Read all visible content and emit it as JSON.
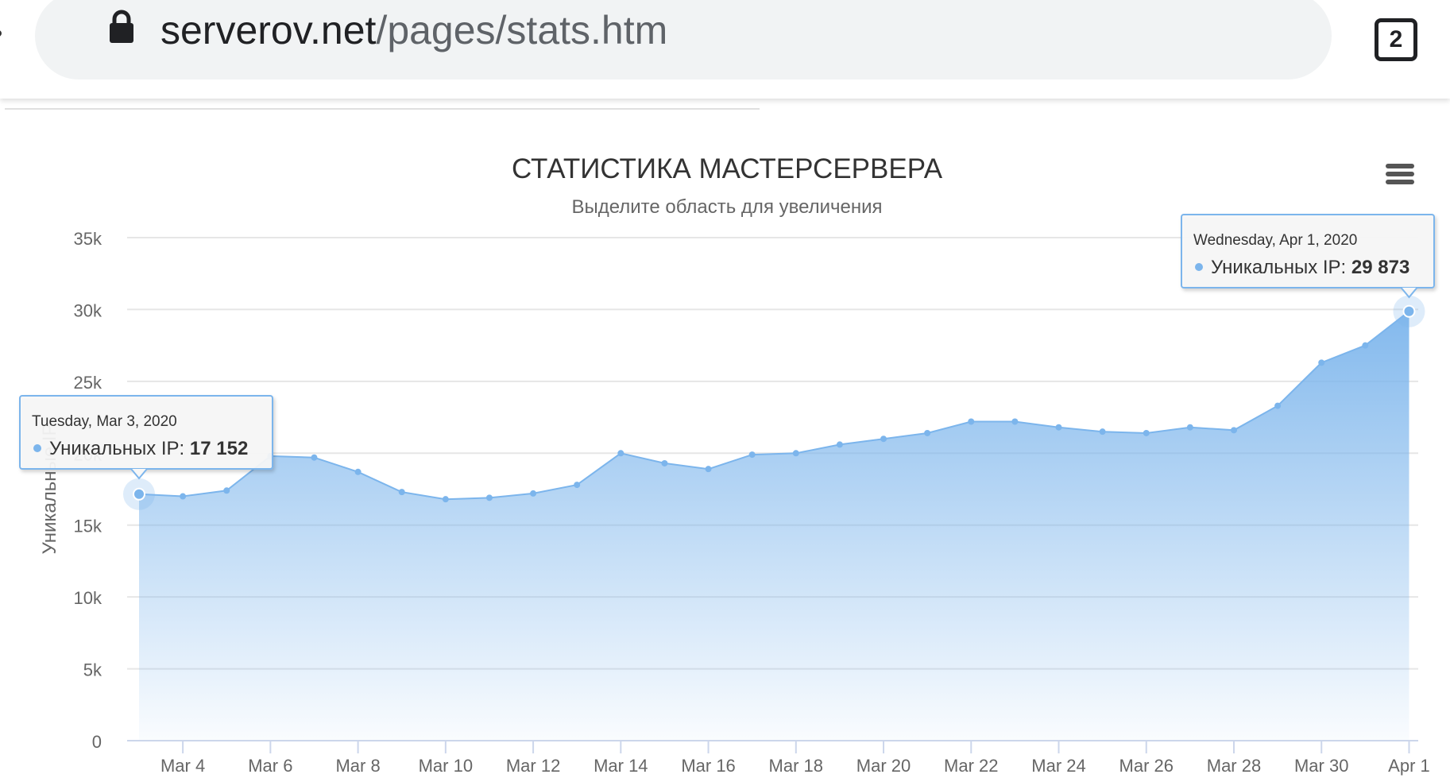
{
  "browser": {
    "url_domain": "serverov.net",
    "url_path": "/pages/stats.htm",
    "tab_count": "2",
    "lock_icon": "lock-icon",
    "menu_icon": "hamburger-menu-icon"
  },
  "chart_data": {
    "type": "area",
    "title": "СТАТИСТИКА МАСТЕРСЕРВЕРА",
    "subtitle": "Выделите область для увеличения",
    "ylabel": "Уникальные IP",
    "ylim": [
      0,
      35000
    ],
    "yticks": [
      "0",
      "5k",
      "10k",
      "15k",
      "20k",
      "25k",
      "30k",
      "35k"
    ],
    "xticks": [
      "Mar 4",
      "Mar 6",
      "Mar 8",
      "Mar 10",
      "Mar 12",
      "Mar 14",
      "Mar 16",
      "Mar 18",
      "Mar 20",
      "Mar 22",
      "Mar 24",
      "Mar 26",
      "Mar 28",
      "Mar 30",
      "Apr 1"
    ],
    "color": "#7cb5ec",
    "grid": true,
    "legend": "none",
    "series": [
      {
        "name": "Уникальных IP",
        "x": [
          "2020-03-03",
          "2020-03-04",
          "2020-03-05",
          "2020-03-06",
          "2020-03-07",
          "2020-03-08",
          "2020-03-09",
          "2020-03-10",
          "2020-03-11",
          "2020-03-12",
          "2020-03-13",
          "2020-03-14",
          "2020-03-15",
          "2020-03-16",
          "2020-03-17",
          "2020-03-18",
          "2020-03-19",
          "2020-03-20",
          "2020-03-21",
          "2020-03-22",
          "2020-03-23",
          "2020-03-24",
          "2020-03-25",
          "2020-03-26",
          "2020-03-27",
          "2020-03-28",
          "2020-03-29",
          "2020-03-30",
          "2020-03-31",
          "2020-04-01"
        ],
        "values": [
          17152,
          17000,
          17400,
          19800,
          19700,
          18700,
          17300,
          16800,
          16900,
          17200,
          17800,
          20000,
          19300,
          18900,
          19900,
          20000,
          20600,
          21000,
          21400,
          22200,
          22200,
          21800,
          21500,
          21400,
          21800,
          21600,
          23300,
          26300,
          27500,
          29873
        ]
      }
    ],
    "tooltips": [
      {
        "date": "Tuesday, Mar 3, 2020",
        "label": "Уникальных IP: ",
        "value": "17 152",
        "index": 0
      },
      {
        "date": "Wednesday, Apr 1, 2020",
        "label": "Уникальных IP: ",
        "value": "29 873",
        "index": 29
      }
    ]
  }
}
